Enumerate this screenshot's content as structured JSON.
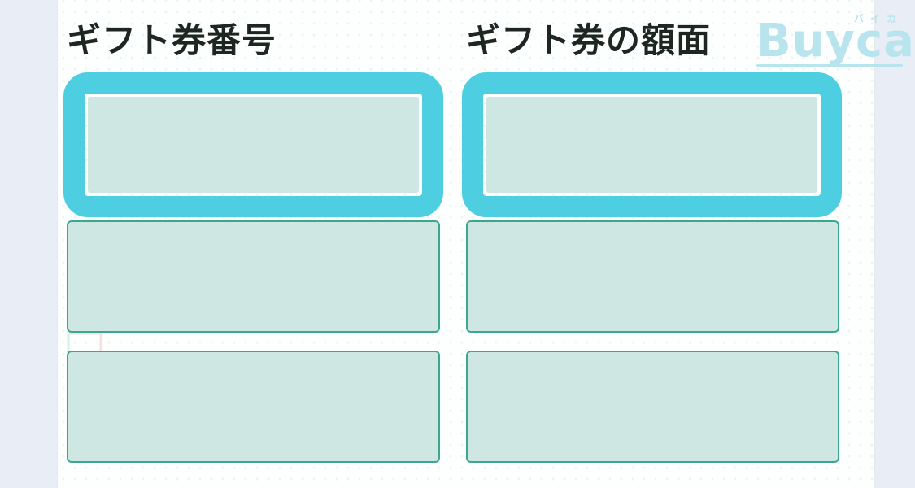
{
  "columns": {
    "left_header": "ギフト券番号",
    "right_header": "ギフト券の額面"
  },
  "rows": [
    {
      "gift_number": "",
      "face_value": "",
      "highlighted": true
    },
    {
      "gift_number": "",
      "face_value": "",
      "highlighted": false
    },
    {
      "gift_number": "",
      "face_value": "",
      "highlighted": false
    }
  ],
  "logo": {
    "text": "Buyca",
    "kana": "バイカ"
  },
  "colors": {
    "highlight": "#4dcfe1",
    "field_fill": "#cfe7e3",
    "field_border": "#3ba791",
    "header_text": "#1d2620",
    "logo": "#b8e4ee"
  }
}
